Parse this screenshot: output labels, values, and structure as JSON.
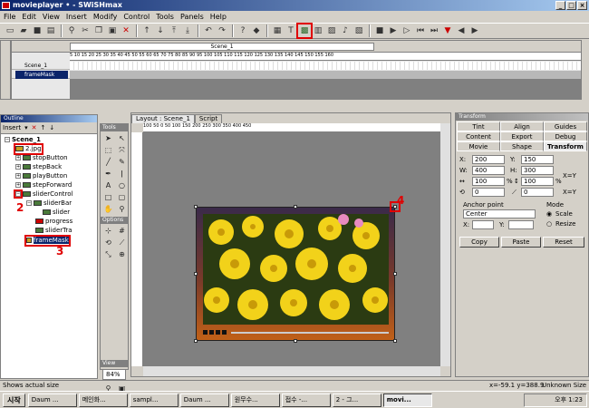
{
  "window": {
    "title": "movieplayer • - SWiSHmax",
    "min": "_",
    "max": "□",
    "close": "×"
  },
  "menu": [
    "File",
    "Edit",
    "View",
    "Insert",
    "Modify",
    "Control",
    "Tools",
    "Panels",
    "Help"
  ],
  "annotations": {
    "one": "1",
    "two": "2",
    "three": "3",
    "four": "4"
  },
  "timeline": {
    "scene": "Scene_1",
    "ruler": "5  10  15  20  25  30  35  40  45  50  55  60  65  70  75  80  85  90  95  100  105  110  115  120  125  130  135  140  145  150  155  160",
    "rows": [
      {
        "name": "Scene_1"
      },
      {
        "name": "frameMask"
      }
    ]
  },
  "outline": {
    "title": "Outline",
    "insert_label": "Insert",
    "items": [
      {
        "label": "Scene_1",
        "indent": 0
      },
      {
        "label": "2.jpg",
        "indent": 1
      },
      {
        "label": "stopButton",
        "indent": 1
      },
      {
        "label": "stepBack",
        "indent": 1
      },
      {
        "label": "playButton",
        "indent": 1
      },
      {
        "label": "stepForward",
        "indent": 1
      },
      {
        "label": "sliderControl",
        "indent": 1
      },
      {
        "label": "sliderBar",
        "indent": 2
      },
      {
        "label": "slider",
        "indent": 3
      },
      {
        "label": "progress",
        "indent": 2
      },
      {
        "label": "sliderTra",
        "indent": 2
      },
      {
        "label": "frameMask",
        "indent": 1
      }
    ]
  },
  "tools": {
    "title": "Tools",
    "options_title": "Options",
    "view_title": "View",
    "zoom": "84%"
  },
  "layout": {
    "tab_layout": "Layout : Scene_1",
    "tab_script": "Script",
    "hruler": "100    50    0    50    100    150    200    250    300    350    400    450"
  },
  "transform": {
    "title": "Transform",
    "tabs": [
      "Tint",
      "Align",
      "Guides",
      "Content",
      "Export",
      "Debug",
      "Movie",
      "Shape",
      "Transform"
    ],
    "x": "200",
    "y": "150",
    "w": "400",
    "h": "300",
    "sx": "100",
    "sy": "100",
    "rot": "0",
    "skew": "0",
    "pct": "%",
    "xy1": "X=Y",
    "xy2": "X=Y",
    "anchor_label": "Anchor point",
    "anchor_value": "Center",
    "ax": "X:",
    "ay": "Y:",
    "mode_label": "Mode",
    "mode_scale": "Scale",
    "mode_resize": "Resize",
    "copy": "Copy",
    "paste": "Paste",
    "reset": "Reset"
  },
  "status": {
    "left": "Shows actual size",
    "coords": "x=-59.1 y=388.9",
    "size": "Unknown Size"
  },
  "taskbar": {
    "start": "시작",
    "tasks": [
      "Daum ...",
      "메인화...",
      "sampl...",
      "Daum ...",
      "원무수...",
      "접수 -...",
      "2 - 그...",
      "movi..."
    ],
    "clock": "오후 1:23"
  }
}
